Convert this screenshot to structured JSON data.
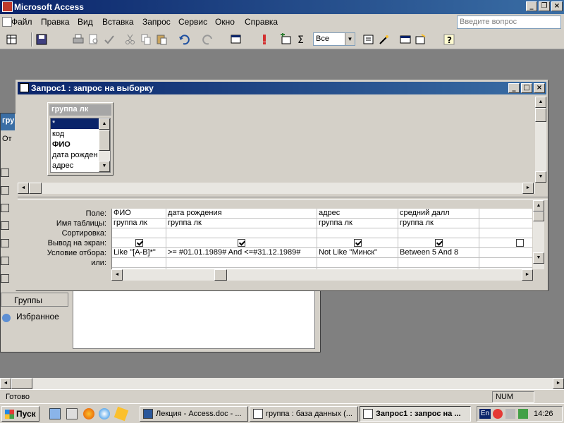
{
  "app": {
    "title": "Microsoft Access"
  },
  "menu": {
    "items": [
      "Файл",
      "Правка",
      "Вид",
      "Вставка",
      "Запрос",
      "Сервис",
      "Окно",
      "Справка"
    ],
    "ask_placeholder": "Введите вопрос"
  },
  "toolbar": {
    "combo_value": "Все"
  },
  "query_window": {
    "title": "Запрос1 : запрос на выборку",
    "table": {
      "name": "группа лк",
      "fields": [
        "*",
        "код",
        "ФИО",
        "дата рожден",
        "адрес"
      ]
    },
    "row_labels": [
      "Поле:",
      "Имя таблицы:",
      "Сортировка:",
      "Вывод на экран:",
      "Условие отбора:",
      "или:"
    ],
    "columns": [
      {
        "field": "ФИО",
        "table": "группа лк",
        "sort": "",
        "show": true,
        "criteria": "Like \"[А-В]*\"",
        "or": ""
      },
      {
        "field": "дата рождения",
        "table": "группа лк",
        "sort": "",
        "show": true,
        "criteria": ">= #01.01.1989# And <=#31.12.1989#",
        "or": ""
      },
      {
        "field": "адрес",
        "table": "группа лк",
        "sort": "",
        "show": true,
        "criteria": "Not Like \"Минск\"",
        "or": ""
      },
      {
        "field": "средний далл",
        "table": "группа лк",
        "sort": "",
        "show": true,
        "criteria": "Between 5 And 8",
        "or": ""
      },
      {
        "field": "",
        "table": "",
        "sort": "",
        "show": false,
        "criteria": "",
        "or": ""
      }
    ]
  },
  "background_window": {
    "left_partial_title": "гру",
    "left_partial_tab": "От",
    "groups_label": "Группы",
    "favorites_label": "Избранное"
  },
  "status": {
    "text": "Готово",
    "num": "NUM"
  },
  "taskbar": {
    "start_label": "Пуск",
    "tasks": [
      {
        "label": "Лекция - Access.doc - ...",
        "active": false
      },
      {
        "label": "группа : база данных (...",
        "active": false
      },
      {
        "label": "Запрос1 : запрос на ...",
        "active": true
      }
    ],
    "lang": "En",
    "clock": "14:26"
  }
}
